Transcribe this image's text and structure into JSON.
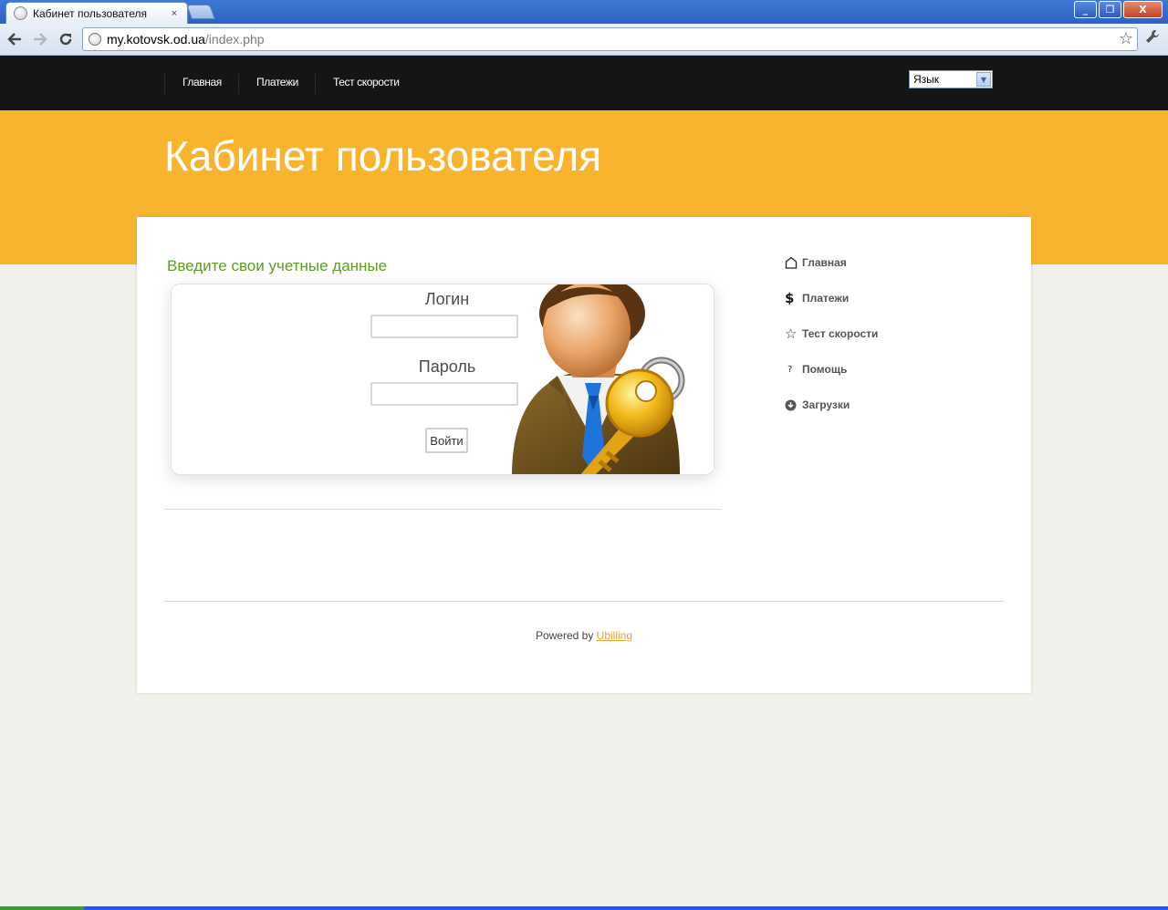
{
  "browser": {
    "tab_title": "Кабинет пользователя",
    "tab_close": "×",
    "url_host": "my.kotovsk.od.ua",
    "url_path": "/index.php",
    "window_buttons": {
      "minimize": "_",
      "maximize": "❐",
      "close": "X"
    }
  },
  "topnav": {
    "items": [
      "Главная",
      "Платежи",
      "Тест скорости"
    ],
    "language_select": "Язык"
  },
  "banner": {
    "title": "Кабинет пользователя"
  },
  "login": {
    "heading": "Введите свои учетные данные",
    "login_label": "Логин",
    "login_value": "",
    "password_label": "Пароль",
    "password_value": "",
    "submit_label": "Войти"
  },
  "side_menu": {
    "items": [
      {
        "label": "Главная",
        "icon": "home-icon"
      },
      {
        "label": "Платежи",
        "icon": "dollar-icon"
      },
      {
        "label": "Тест скорости",
        "icon": "star-icon"
      },
      {
        "label": "Помощь",
        "icon": "question-icon"
      },
      {
        "label": "Загрузки",
        "icon": "download-icon"
      }
    ]
  },
  "footer": {
    "powered_by": "Powered by",
    "link_label": "Ubilling"
  },
  "colors": {
    "banner": "#f9b42f",
    "nav_background": "#151515",
    "heading_green": "#5b9d1f",
    "link_orange": "#e0a330",
    "page_background": "#f1f1ec"
  }
}
